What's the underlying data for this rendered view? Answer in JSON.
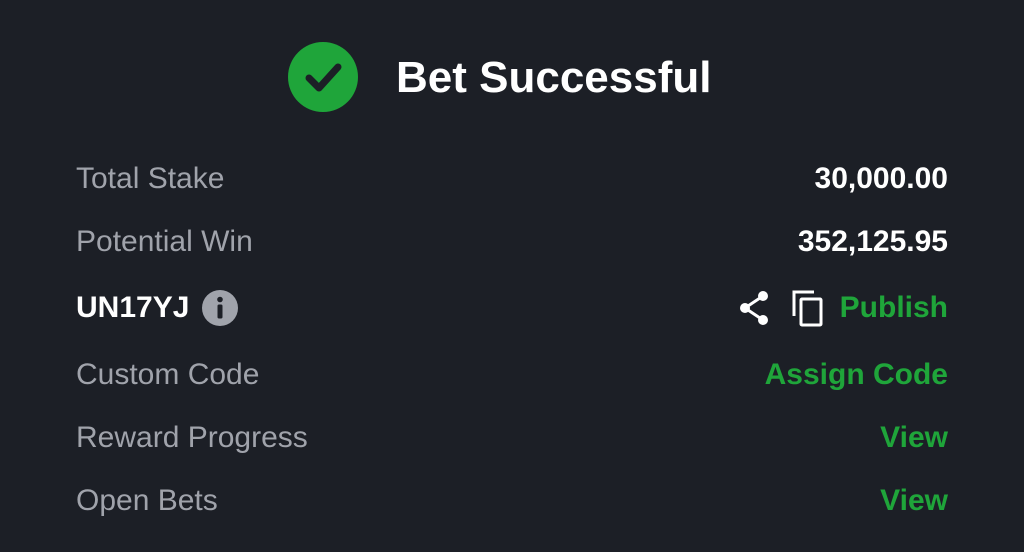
{
  "header": {
    "title": "Bet Successful",
    "icon": "check-circle-icon",
    "accent_color": "#1fa53a"
  },
  "rows": {
    "total_stake": {
      "label": "Total Stake",
      "value": "30,000.00"
    },
    "potential_win": {
      "label": "Potential Win",
      "value": "352,125.95"
    },
    "booking": {
      "code": "UN17YJ",
      "info_icon": "info-icon",
      "share_icon": "share-icon",
      "copy_icon": "copy-icon",
      "publish_label": "Publish"
    },
    "custom_code": {
      "label": "Custom Code",
      "action": "Assign Code"
    },
    "reward_progress": {
      "label": "Reward Progress",
      "action": "View"
    },
    "open_bets": {
      "label": "Open Bets",
      "action": "View"
    }
  },
  "colors": {
    "background": "#1c1f26",
    "label": "#a0a3ab",
    "value": "#ffffff",
    "link": "#1fa53a"
  }
}
